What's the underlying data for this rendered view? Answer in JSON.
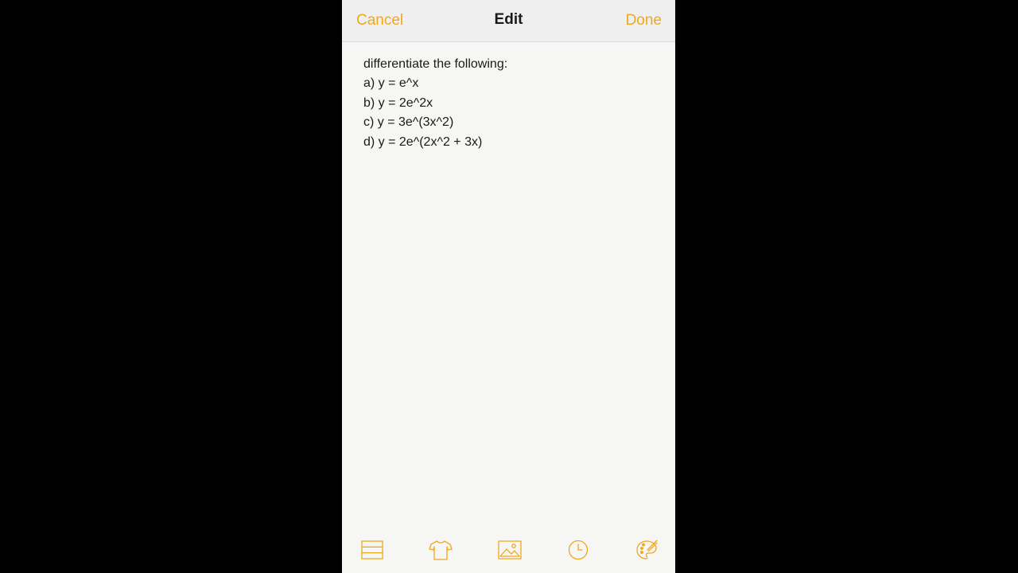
{
  "nav": {
    "cancel_label": "Cancel",
    "title": "Edit",
    "done_label": "Done"
  },
  "note": {
    "lines": [
      "differentiate the following:",
      "a) y = e^x",
      "b) y = 2e^2x",
      "c) y = 3e^(3x^2)",
      "d) y = 2e^(2x^2 + 3x)"
    ]
  },
  "toolbar": {
    "icons": [
      "list-lines-icon",
      "tshirt-icon",
      "image-icon",
      "clock-icon",
      "palette-icon"
    ]
  },
  "colors": {
    "accent": "#f0a81c",
    "page_background": "#f6f6f4",
    "navbar_background": "#efefef",
    "letterbox": "#000000"
  }
}
